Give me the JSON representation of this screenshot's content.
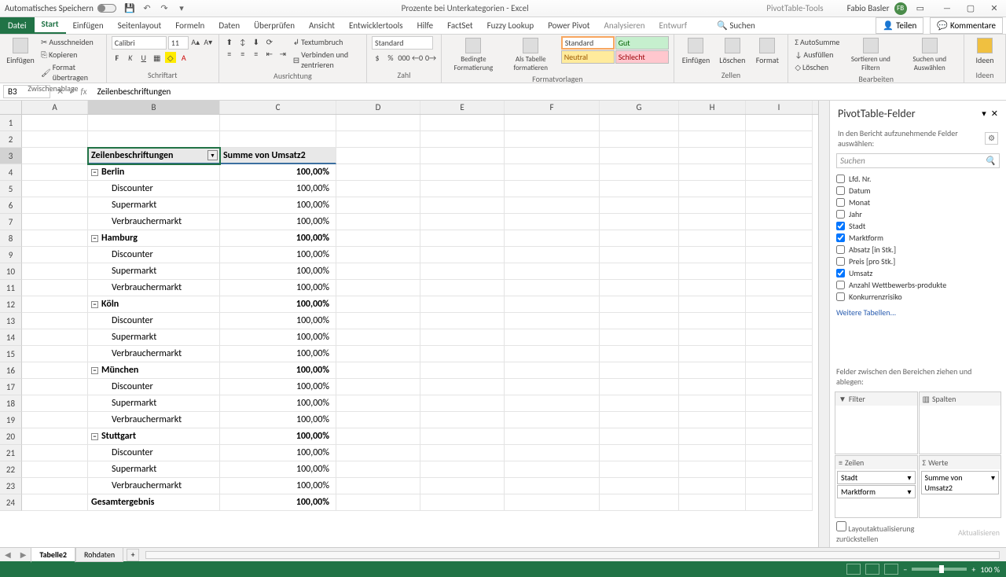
{
  "titlebar": {
    "autosave": "Automatisches Speichern",
    "doc_title": "Prozente bei Unterkategorien - Excel",
    "contextual": "PivotTable-Tools",
    "user_name": "Fabio Basler",
    "user_initials": "FB"
  },
  "tabs": {
    "file": "Datei",
    "list": [
      "Start",
      "Einfügen",
      "Seitenlayout",
      "Formeln",
      "Daten",
      "Überprüfen",
      "Ansicht",
      "Entwicklertools",
      "Hilfe",
      "FactSet",
      "Fuzzy Lookup",
      "Power Pivot"
    ],
    "contextual": [
      "Analysieren",
      "Entwurf"
    ],
    "search": "Suchen",
    "share": "Teilen",
    "comments": "Kommentare"
  },
  "ribbon": {
    "clipboard": {
      "paste": "Einfügen",
      "cut": "Ausschneiden",
      "copy": "Kopieren",
      "format": "Format übertragen",
      "label": "Zwischenablage"
    },
    "font": {
      "name": "Calibri",
      "size": "11",
      "label": "Schriftart"
    },
    "align": {
      "wrap": "Textumbruch",
      "merge": "Verbinden und zentrieren",
      "label": "Ausrichtung"
    },
    "number": {
      "format": "Standard",
      "label": "Zahl"
    },
    "styles": {
      "cond": "Bedingte Formatierung",
      "table": "Als Tabelle formatieren",
      "s1": "Standard",
      "s2": "Gut",
      "s3": "Neutral",
      "s4": "Schlecht",
      "label": "Formatvorlagen"
    },
    "cells": {
      "insert": "Einfügen",
      "delete": "Löschen",
      "format": "Format",
      "label": "Zellen"
    },
    "editing": {
      "sum": "AutoSumme",
      "fill": "Ausfüllen",
      "clear": "Löschen",
      "sort": "Sortieren und Filtern",
      "find": "Suchen und Auswählen",
      "label": "Bearbeiten"
    },
    "ideas": {
      "label": "Ideen"
    }
  },
  "formula_bar": {
    "name_box": "B3",
    "formula": "Zeilenbeschriftungen"
  },
  "columns": [
    "A",
    "B",
    "C",
    "D",
    "E",
    "F",
    "G",
    "H",
    "I"
  ],
  "pivot_data": {
    "header_b": "Zeilenbeschriftungen",
    "header_c": "Summe von Umsatz2",
    "rows": [
      {
        "n": 4,
        "b": "Berlin",
        "c": "100,00%",
        "bold": true,
        "expand": true
      },
      {
        "n": 5,
        "b": "Discounter",
        "c": "100,00%",
        "indent": true
      },
      {
        "n": 6,
        "b": "Supermarkt",
        "c": "100,00%",
        "indent": true
      },
      {
        "n": 7,
        "b": "Verbrauchermarkt",
        "c": "100,00%",
        "indent": true
      },
      {
        "n": 8,
        "b": "Hamburg",
        "c": "100,00%",
        "bold": true,
        "expand": true
      },
      {
        "n": 9,
        "b": "Discounter",
        "c": "100,00%",
        "indent": true
      },
      {
        "n": 10,
        "b": "Supermarkt",
        "c": "100,00%",
        "indent": true
      },
      {
        "n": 11,
        "b": "Verbrauchermarkt",
        "c": "100,00%",
        "indent": true
      },
      {
        "n": 12,
        "b": "Köln",
        "c": "100,00%",
        "bold": true,
        "expand": true
      },
      {
        "n": 13,
        "b": "Discounter",
        "c": "100,00%",
        "indent": true
      },
      {
        "n": 14,
        "b": "Supermarkt",
        "c": "100,00%",
        "indent": true
      },
      {
        "n": 15,
        "b": "Verbrauchermarkt",
        "c": "100,00%",
        "indent": true
      },
      {
        "n": 16,
        "b": "München",
        "c": "100,00%",
        "bold": true,
        "expand": true
      },
      {
        "n": 17,
        "b": "Discounter",
        "c": "100,00%",
        "indent": true
      },
      {
        "n": 18,
        "b": "Supermarkt",
        "c": "100,00%",
        "indent": true
      },
      {
        "n": 19,
        "b": "Verbrauchermarkt",
        "c": "100,00%",
        "indent": true
      },
      {
        "n": 20,
        "b": "Stuttgart",
        "c": "100,00%",
        "bold": true,
        "expand": true
      },
      {
        "n": 21,
        "b": "Discounter",
        "c": "100,00%",
        "indent": true
      },
      {
        "n": 22,
        "b": "Supermarkt",
        "c": "100,00%",
        "indent": true
      },
      {
        "n": 23,
        "b": "Verbrauchermarkt",
        "c": "100,00%",
        "indent": true
      },
      {
        "n": 24,
        "b": "Gesamtergebnis",
        "c": "100,00%",
        "bold": true
      }
    ]
  },
  "pivot_panel": {
    "title": "PivotTable-Felder",
    "subtitle": "In den Bericht aufzunehmende Felder auswählen:",
    "search_placeholder": "Suchen",
    "fields": [
      {
        "name": "Lfd. Nr.",
        "checked": false
      },
      {
        "name": "Datum",
        "checked": false
      },
      {
        "name": "Monat",
        "checked": false
      },
      {
        "name": "Jahr",
        "checked": false
      },
      {
        "name": "Stadt",
        "checked": true
      },
      {
        "name": "Marktform",
        "checked": true
      },
      {
        "name": "Absatz [in Stk.]",
        "checked": false
      },
      {
        "name": "Preis [pro Stk.]",
        "checked": false
      },
      {
        "name": "Umsatz",
        "checked": true
      },
      {
        "name": "Anzahl Wettbewerbs-produkte",
        "checked": false
      },
      {
        "name": "Konkurrenzrisiko",
        "checked": false
      }
    ],
    "more_tables": "Weitere Tabellen...",
    "areas_label": "Felder zwischen den Bereichen ziehen und ablegen:",
    "filter": "Filter",
    "columns": "Spalten",
    "rows_label": "Zeilen",
    "values": "Werte",
    "row_items": [
      "Stadt",
      "Marktform"
    ],
    "value_items": [
      "Summe von Umsatz2"
    ],
    "defer": "Layoutaktualisierung zurückstellen",
    "update": "Aktualisieren"
  },
  "sheets": {
    "active": "Tabelle2",
    "other": "Rohdaten"
  },
  "status": {
    "zoom": "100 %"
  }
}
